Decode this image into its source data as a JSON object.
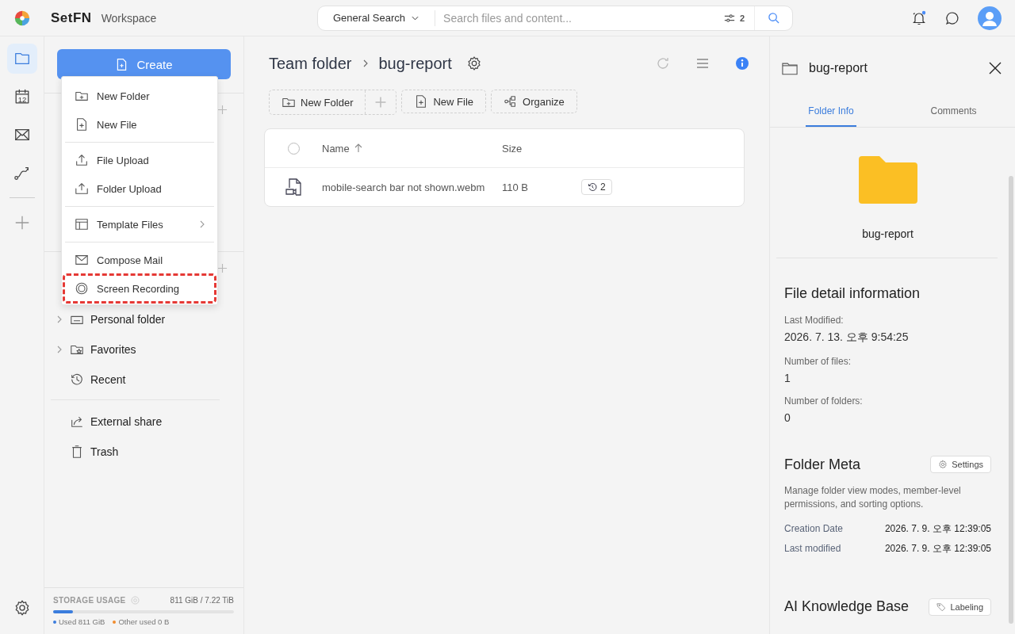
{
  "app": {
    "name": "SetFN",
    "section": "Workspace"
  },
  "search": {
    "scope": "General Search",
    "placeholder": "Search files and content...",
    "filter_count": "2"
  },
  "header": {
    "notification_unread": true
  },
  "rail": [
    {
      "kind": "folder",
      "selected": true
    },
    {
      "kind": "calendar",
      "selected": false,
      "label": "12"
    },
    {
      "kind": "mail",
      "selected": false
    },
    {
      "kind": "route",
      "selected": false
    }
  ],
  "create_button": "Create",
  "create_menu": [
    [
      {
        "kind": "new-folder",
        "label": "New Folder",
        "highlighted": false
      },
      {
        "kind": "new-file",
        "label": "New File",
        "highlighted": false
      }
    ],
    [
      {
        "kind": "upload",
        "label": "File Upload",
        "highlighted": false
      },
      {
        "kind": "folder-upload",
        "label": "Folder Upload",
        "highlighted": false
      }
    ],
    [
      {
        "kind": "template",
        "label": "Template Files",
        "highlighted": false,
        "submenu": true
      }
    ],
    [
      {
        "kind": "mail",
        "label": "Compose Mail",
        "highlighted": false
      },
      {
        "kind": "record",
        "label": "Screen Recording",
        "highlighted": true
      }
    ]
  ],
  "sidebar": {
    "items": [
      {
        "kind": "personal",
        "label": "Personal folder",
        "expandable": true
      },
      {
        "kind": "favorites",
        "label": "Favorites",
        "expandable": true
      },
      {
        "kind": "recent",
        "label": "Recent",
        "expandable": false
      }
    ],
    "links": [
      {
        "kind": "share",
        "label": "External share"
      },
      {
        "kind": "trash",
        "label": "Trash"
      }
    ]
  },
  "storage": {
    "title": "STORAGE USAGE",
    "summary": "811 GiB / 7.22 TiB",
    "level": 0.11,
    "used": "Used 811 GiB",
    "other": "Other used 0 B"
  },
  "breadcrumb": [
    "Team folder",
    "bug-report"
  ],
  "toolbar": [
    {
      "kind": "new-folder",
      "label": "New Folder"
    },
    {
      "kind": "new-file",
      "label": "New File"
    },
    {
      "kind": "organize",
      "label": "Organize"
    }
  ],
  "table": {
    "select_all_checked": false,
    "columns": [
      "Name",
      "Size"
    ],
    "rows": [
      {
        "name": "mobile-search bar not shown.webm",
        "size": "110 B",
        "versions": "2",
        "selected": false
      }
    ]
  },
  "panel": {
    "title": "bug-report",
    "tabs": [
      {
        "label": "Folder Info",
        "selected": true
      },
      {
        "label": "Comments",
        "selected": false
      }
    ],
    "folder_name": "bug-report",
    "details": {
      "title": "File detail information",
      "fields": [
        {
          "label": "Last Modified:",
          "value": "2026. 7. 13. 오후 9:54:25"
        },
        {
          "label": "Number of files:",
          "value": "1"
        },
        {
          "label": "Number of folders:",
          "value": "0"
        }
      ]
    },
    "meta": {
      "title": "Folder Meta",
      "button": "Settings",
      "description": "Manage folder view modes, member-level permissions, and sorting options.",
      "rows": [
        {
          "label": "Creation Date",
          "value": "2026. 7. 9. 오후 12:39:05"
        },
        {
          "label": "Last modified",
          "value": "2026. 7. 9. 오후 12:39:05"
        }
      ]
    },
    "ai": {
      "title": "AI Knowledge Base",
      "button": "Labeling"
    }
  }
}
